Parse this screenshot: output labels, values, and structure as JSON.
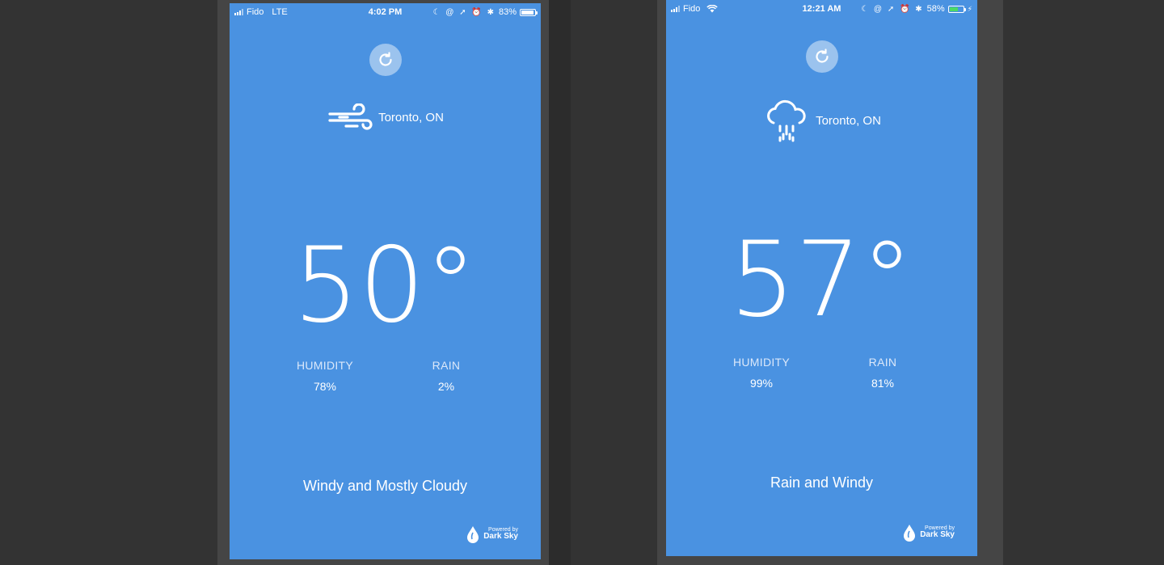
{
  "screens": [
    {
      "status": {
        "carrier": "Fido",
        "network": "LTE",
        "time": "4:02 PM",
        "battery": "83%",
        "battery_level": 0.83,
        "battery_color": "#ffffff"
      },
      "weather_icon": "wind-icon",
      "location": "Toronto, ON",
      "temperature": "50°",
      "humidity_label": "HUMIDITY",
      "humidity_value": "78%",
      "rain_label": "RAIN",
      "rain_value": "2%",
      "summary": "Windy and Mostly Cloudy",
      "powered_by_line1": "Powered by",
      "powered_by_line2": "Dark Sky"
    },
    {
      "status": {
        "carrier": "Fido",
        "network": "wifi",
        "time": "12:21 AM",
        "battery": "58%",
        "battery_level": 0.58,
        "battery_color": "#4cd964"
      },
      "weather_icon": "rain-cloud-icon",
      "location": "Toronto, ON",
      "temperature": "57°",
      "humidity_label": "HUMIDITY",
      "humidity_value": "99%",
      "rain_label": "RAIN",
      "rain_value": "81%",
      "summary": "Rain and Windy",
      "powered_by_line1": "Powered by",
      "powered_by_line2": "Dark Sky"
    }
  ],
  "colors": {
    "app_background": "#4a92e1",
    "page_background": "#333333"
  }
}
